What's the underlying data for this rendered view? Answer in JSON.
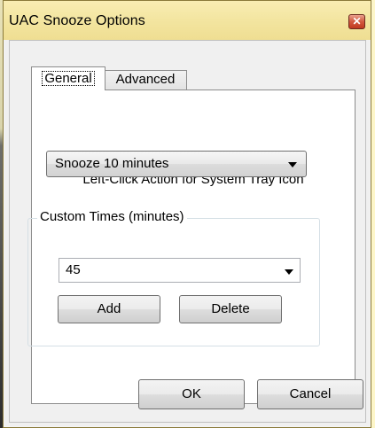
{
  "window": {
    "title": "UAC Snooze Options",
    "close_glyph": "✕"
  },
  "tabs": [
    {
      "label": "General",
      "selected": true
    },
    {
      "label": "Advanced",
      "selected": false
    }
  ],
  "general": {
    "left_click_label": "Left-Click Action for System Tray Icon",
    "left_click_value": "Snooze 10 minutes",
    "custom_times": {
      "title": "Custom Times (minutes)",
      "value": "45",
      "add_label": "Add",
      "delete_label": "Delete"
    }
  },
  "footer": {
    "ok_label": "OK",
    "cancel_label": "Cancel"
  },
  "colors": {
    "titlebar": "#f3e5a0",
    "close_button": "#d2583e",
    "backdrop": "#fdf6c9"
  },
  "icons": {
    "close": "close-icon",
    "dropdown": "chevron-down-icon"
  }
}
